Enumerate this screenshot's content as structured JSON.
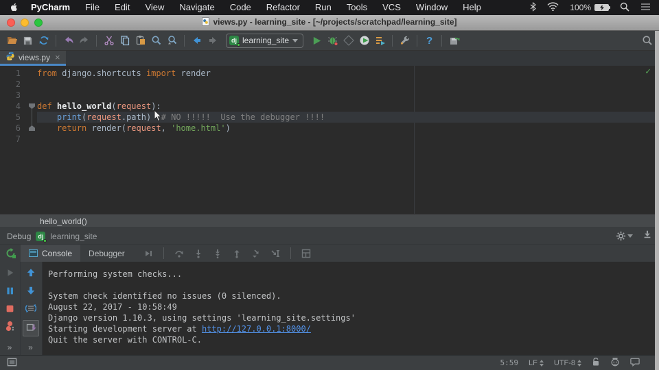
{
  "menubar": {
    "items": [
      "PyCharm",
      "File",
      "Edit",
      "View",
      "Navigate",
      "Code",
      "Refactor",
      "Run",
      "Tools",
      "VCS",
      "Window",
      "Help"
    ],
    "battery_label": "100%",
    "status_icons": [
      "bluetooth-icon",
      "wifi-icon",
      "battery-icon",
      "spotlight-search-icon",
      "notification-center-icon"
    ]
  },
  "titlebar": {
    "title": "views.py - learning_site - [~/projects/scratchpad/learning_site]"
  },
  "toolbar": {
    "run_config": {
      "badge": "dj",
      "name": "learning_site"
    },
    "help_label": "?",
    "icon_names": [
      "open-folder-icon",
      "save-all-icon",
      "synchronize-icon",
      "undo-icon",
      "redo-icon",
      "cut-icon",
      "copy-icon",
      "paste-icon",
      "find-icon",
      "replace-in-path-icon",
      "back-icon",
      "forward-icon",
      "run-icon",
      "debug-icon",
      "run-with-coverage-icon",
      "profiler-icon",
      "concurrency-diagram-icon",
      "settings-wrench-icon",
      "help-icon",
      "save-with-sync-icon",
      "search-everywhere-icon"
    ]
  },
  "tabbar": {
    "tabs": [
      {
        "label": "views.py",
        "close": "×"
      }
    ]
  },
  "editor": {
    "inspection_ok": "✓",
    "lines": [
      {
        "num": "1",
        "tokens": [
          {
            "t": "from ",
            "c": "kw"
          },
          {
            "t": "django.shortcuts ",
            "c": "pl"
          },
          {
            "t": "import ",
            "c": "kw"
          },
          {
            "t": "render",
            "c": "pl"
          }
        ]
      },
      {
        "num": "2",
        "tokens": []
      },
      {
        "num": "3",
        "tokens": []
      },
      {
        "num": "4",
        "fold": "start",
        "tokens": [
          {
            "t": "def ",
            "c": "kw"
          },
          {
            "t": "hello_world",
            "c": "fn"
          },
          {
            "t": "(",
            "c": "pl"
          },
          {
            "t": "request",
            "c": "param"
          },
          {
            "t": "):",
            "c": "pl"
          }
        ]
      },
      {
        "num": "5",
        "current": true,
        "tokens": [
          {
            "t": "    ",
            "c": "pl"
          },
          {
            "t": "print",
            "c": "builtin"
          },
          {
            "t": "(",
            "c": "pl"
          },
          {
            "t": "request",
            "c": "param"
          },
          {
            "t": ".path)  ",
            "c": "pl"
          },
          {
            "t": "# NO !!!!!  Use the debugger !!!!",
            "c": "comment"
          }
        ]
      },
      {
        "num": "6",
        "fold": "end",
        "tokens": [
          {
            "t": "    ",
            "c": "pl"
          },
          {
            "t": "return ",
            "c": "kw"
          },
          {
            "t": "render(",
            "c": "pl"
          },
          {
            "t": "request",
            "c": "param"
          },
          {
            "t": ", ",
            "c": "pl"
          },
          {
            "t": "'home.html'",
            "c": "str"
          },
          {
            "t": ")",
            "c": "pl"
          }
        ]
      },
      {
        "num": "7",
        "tokens": []
      }
    ]
  },
  "frame_bar": {
    "label": "hello_world()"
  },
  "debug": {
    "header": {
      "title": "Debug",
      "badge": "dj",
      "config": "learning_site"
    },
    "tabs": [
      {
        "label": "Console"
      },
      {
        "label": "Debugger"
      }
    ],
    "more_label": "»",
    "left_icon_names": [
      "resume-icon",
      "pause-icon",
      "stop-icon",
      "view-breakpoints-icon",
      "more-chevron",
      "step-up-icon",
      "step-down-icon",
      "restore-frame-icon",
      "scroll-to-end-icon"
    ],
    "step_icon_names": [
      "show-execution-point-icon",
      "step-over-icon",
      "step-into-icon",
      "force-step-into-icon",
      "step-out-icon",
      "run-to-cursor-icon",
      "evaluate-expression-icon",
      "restore-layout-icon"
    ]
  },
  "console": {
    "lines": [
      {
        "segments": [
          {
            "t": "Performing system checks..."
          }
        ]
      },
      {
        "segments": []
      },
      {
        "segments": [
          {
            "t": "System check identified no issues (0 silenced)."
          }
        ]
      },
      {
        "segments": [
          {
            "t": "August 22, 2017 - 10:58:49"
          }
        ]
      },
      {
        "segments": [
          {
            "t": "Django version 1.10.3, using settings 'learning_site.settings'"
          }
        ]
      },
      {
        "segments": [
          {
            "t": "Starting development server at "
          },
          {
            "t": "http://127.0.0.1:8000/",
            "link": true
          }
        ]
      },
      {
        "segments": [
          {
            "t": "Quit the server with CONTROL-C."
          }
        ]
      }
    ]
  },
  "statusbar": {
    "position": "5:59",
    "line_sep": "LF",
    "encoding": "UTF-8",
    "icon_names": [
      "toolwindow-switcher-icon",
      "unlocked-icon",
      "hector-inspector-icon",
      "event-log-icon"
    ]
  },
  "colors": {
    "chrome": "#3c3f41",
    "editor_bg": "#2b2b2b",
    "keyword": "#cc7832",
    "string": "#74a85c",
    "comment": "#808080",
    "param": "#e8957e",
    "builtin": "#6a9fd6",
    "link": "#5394ec",
    "tab_underline": "#4a88c7",
    "django_green": "#2d8745",
    "run_green": "#4b9e55",
    "stop_red": "#cf5650"
  }
}
